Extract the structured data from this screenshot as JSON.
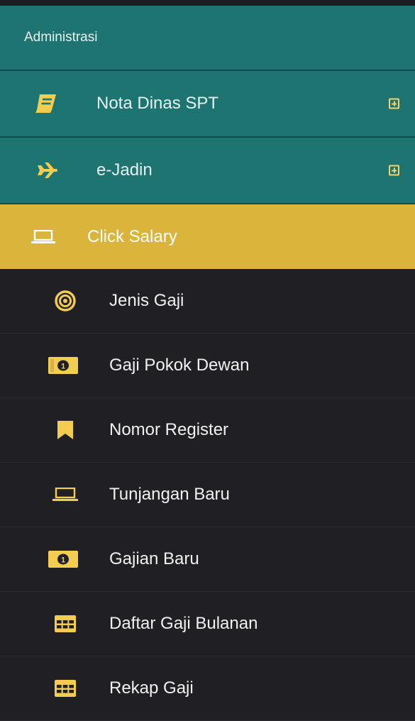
{
  "sidebar": {
    "section_header": "Administrasi",
    "items": [
      {
        "label": "Nota Dinas SPT",
        "icon": "book-icon"
      },
      {
        "label": "e-Jadin",
        "icon": "plane-icon"
      },
      {
        "label": "Click Salary",
        "icon": "laptop-icon",
        "active": true
      }
    ],
    "sub_items": [
      {
        "label": "Jenis Gaji",
        "icon": "bullseye-icon"
      },
      {
        "label": "Gaji Pokok Dewan",
        "icon": "money-bill-icon"
      },
      {
        "label": "Nomor Register",
        "icon": "bookmark-icon"
      },
      {
        "label": "Tunjangan Baru",
        "icon": "laptop-icon"
      },
      {
        "label": "Gajian Baru",
        "icon": "money-bill-icon"
      },
      {
        "label": "Daftar Gaji Bulanan",
        "icon": "table-icon"
      },
      {
        "label": "Rekap Gaji",
        "icon": "table-icon"
      }
    ]
  },
  "colors": {
    "teal": "#1d7470",
    "active": "#dbb43c",
    "dark": "#202024",
    "icon_yellow": "#f2cd50"
  }
}
